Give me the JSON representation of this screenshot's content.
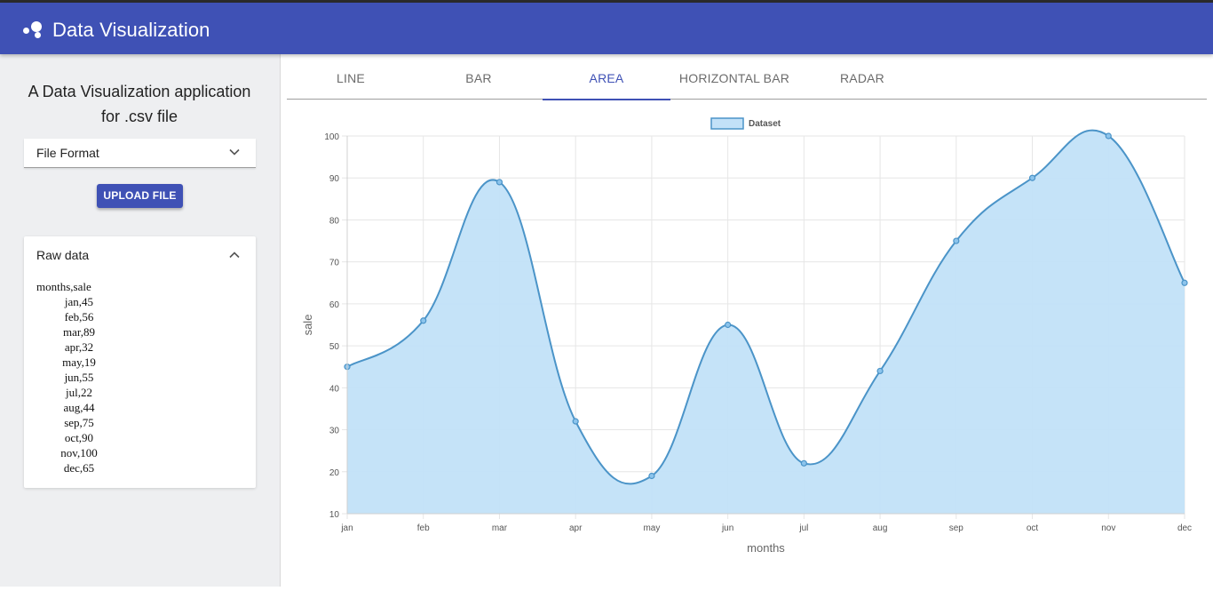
{
  "theme": {
    "primary": "#3f51b5",
    "area_fill": "#c2e1f8",
    "line_color": "#4b94c8"
  },
  "appbar": {
    "title": "Data Visualization",
    "logo_icon": "bubbles-icon"
  },
  "sidebar": {
    "intro_line1": "A Data Visualization application",
    "intro_line2": "for .csv file",
    "file_format": {
      "label": "File Format",
      "icon": "chevron-down-icon"
    },
    "upload_label": "UPLOAD FILE",
    "raw": {
      "title": "Raw data",
      "icon": "chevron-up-icon",
      "lines": [
        "months,sale",
        "jan,45",
        "feb,56",
        "mar,89",
        "apr,32",
        "may,19",
        "jun,55",
        "jul,22",
        "aug,44",
        "sep,75",
        "oct,90",
        "nov,100",
        "dec,65"
      ]
    }
  },
  "tabs": [
    {
      "label": "LINE",
      "active": false
    },
    {
      "label": "BAR",
      "active": false
    },
    {
      "label": "AREA",
      "active": true
    },
    {
      "label": "HORIZONTAL BAR",
      "active": false
    },
    {
      "label": "RADAR",
      "active": false
    }
  ],
  "chart_data": {
    "type": "area",
    "categories": [
      "jan",
      "feb",
      "mar",
      "apr",
      "may",
      "jun",
      "jul",
      "aug",
      "sep",
      "oct",
      "nov",
      "dec"
    ],
    "series": [
      {
        "name": "Dataset",
        "values": [
          45,
          56,
          89,
          32,
          19,
          55,
          22,
          44,
          75,
          90,
          100,
          65
        ]
      }
    ],
    "xlabel": "months",
    "ylabel": "sale",
    "ylim": [
      10,
      100
    ],
    "yticks": [
      10,
      20,
      30,
      40,
      50,
      60,
      70,
      80,
      90,
      100
    ],
    "grid": true,
    "legend": "top-center"
  }
}
